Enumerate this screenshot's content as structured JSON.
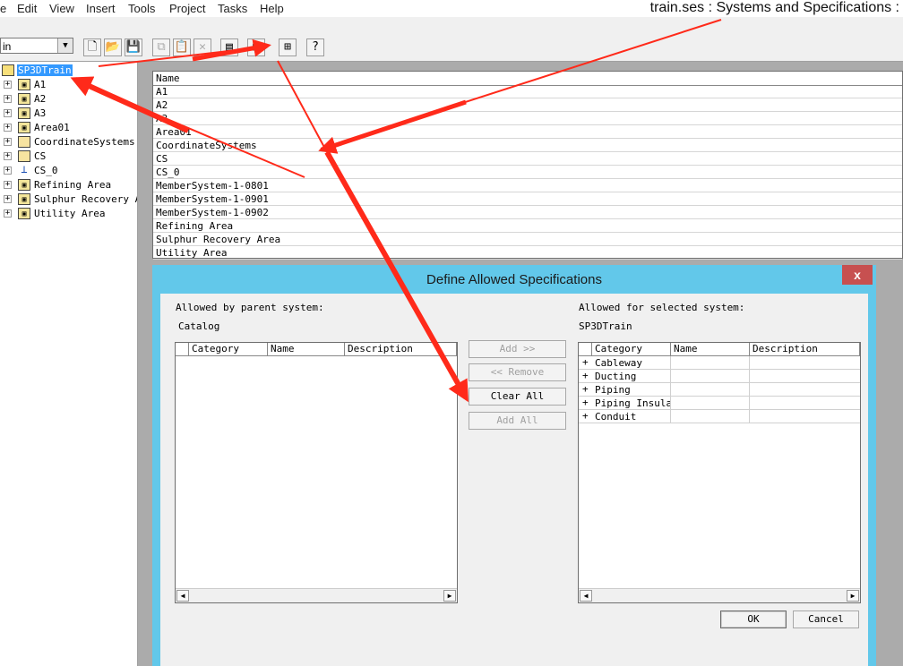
{
  "window": {
    "title": "train.ses : Systems and Specifications :"
  },
  "menu": [
    "e",
    "Edit",
    "View",
    "Insert",
    "Tools",
    "Project",
    "Tasks",
    "Help"
  ],
  "toolbar": {
    "combo_value": "in"
  },
  "tree": {
    "root": "SP3DTrain",
    "items": [
      "A1",
      "A2",
      "A3",
      "Area01",
      "CoordinateSystems",
      "CS",
      "CS_0",
      "Refining Area",
      "Sulphur Recovery Ar",
      "Utility Area"
    ]
  },
  "list": {
    "header": "Name",
    "rows": [
      "A1",
      "A2",
      "A3",
      "Area01",
      "CoordinateSystems",
      "CS",
      "CS_0",
      "MemberSystem-1-0801",
      "MemberSystem-1-0901",
      "MemberSystem-1-0902",
      "Refining Area",
      "Sulphur Recovery Area",
      "Utility Area"
    ]
  },
  "dialog": {
    "title": "Define Allowed Specifications",
    "close_label": "x",
    "left_label": "Allowed by parent system:",
    "left_sublabel": "Catalog",
    "right_label": "Allowed for selected system:",
    "right_sublabel": "SP3DTrain",
    "columns": [
      "Category",
      "Name",
      "Description"
    ],
    "right_rows": [
      "Cableway",
      "Ducting",
      "Piping",
      "Piping Insulat",
      "Conduit"
    ],
    "buttons": {
      "add": "Add >>",
      "remove": "<< Remove",
      "clear_all": "Clear All",
      "add_all": "Add All",
      "ok": "OK",
      "cancel": "Cancel"
    }
  },
  "colors": {
    "dialog_frame": "#62c8ea",
    "close_button": "#c75050",
    "selection": "#3399ff",
    "annotation_arrow": "#ff2a1a"
  }
}
